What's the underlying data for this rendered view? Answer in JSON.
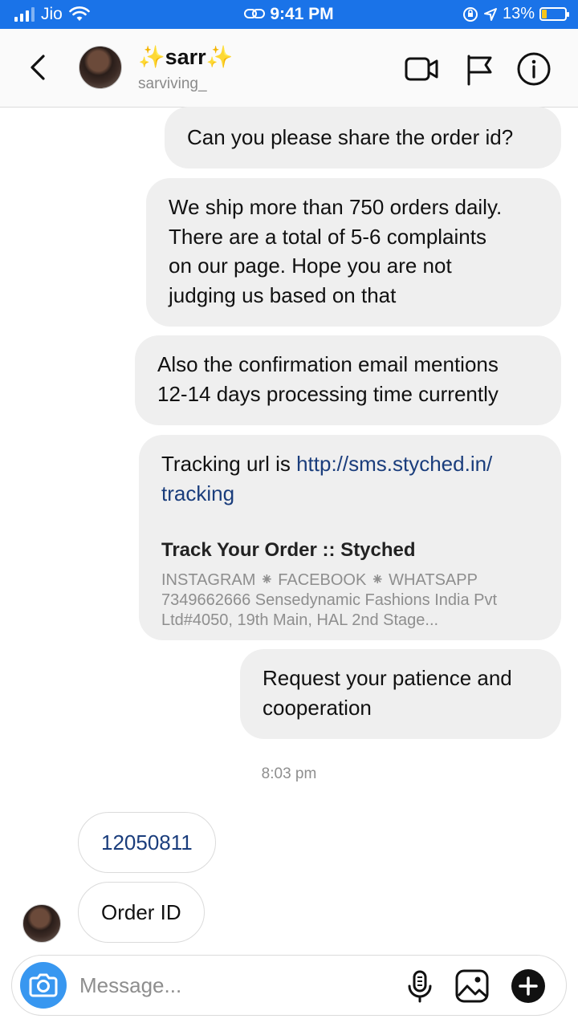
{
  "status_bar": {
    "carrier": "Jio",
    "time": "9:41 PM",
    "battery": "13%",
    "battery_level": 0.13,
    "icons": [
      "signal-icon",
      "wifi-icon",
      "link-icon",
      "orientation-lock-icon",
      "location-arrow-icon",
      "battery-icon"
    ]
  },
  "header": {
    "title_sparkle_left": "✨",
    "title": "sarr",
    "title_sparkle_right": "✨",
    "username": "sarviving_",
    "icons": [
      "back-chevron-icon",
      "video-camera-icon",
      "flag-icon",
      "info-icon"
    ]
  },
  "messages": {
    "m1": "Can you please share the order id?",
    "m2_lines": [
      "We ship more than 750 orders daily.",
      "There are a total of 5-6 complaints",
      "on our page. Hope you are not",
      "judging us based on that"
    ],
    "m3_lines": [
      "Also the confirmation email mentions",
      "12-14 days processing time currently"
    ],
    "m4_prefix": "Tracking url is ",
    "m4_link_line1": "http://sms.styched.in/",
    "m4_link_line2": "tracking",
    "m4_preview_title": "Track Your Order :: Styched",
    "m4_preview_desc_lines": [
      "INSTAGRAM ⁕ FACEBOOK ⁕ WHATSAPP",
      "7349662666 Sensedynamic Fashions India Pvt",
      "Ltd#4050, 19th Main, HAL 2nd Stage..."
    ],
    "m5_lines": [
      "Request your patience and",
      "cooperation"
    ],
    "timestamp": "8:03 pm",
    "in1": "12050811",
    "in2": "Order ID"
  },
  "composer": {
    "placeholder": "Message...",
    "icons": [
      "camera-icon",
      "microphone-icon",
      "gallery-icon",
      "plus-icon"
    ]
  },
  "colors": {
    "status_bar": "#1a73e8",
    "bubble_gray": "#efefef",
    "link": "#1a3d7c",
    "camera_button": "#3897f0"
  }
}
